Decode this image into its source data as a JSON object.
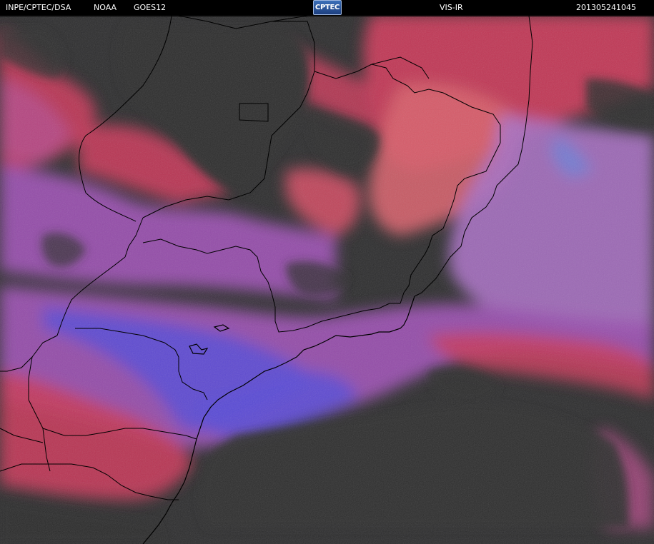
{
  "header": {
    "agency": "INPE/CPTEC/DSA",
    "source": "NOAA",
    "satellite": "GOES12",
    "logo_text": "CPTEC",
    "product": "VIS-IR",
    "timestamp": "201305241045"
  },
  "colors": {
    "background": "#000000",
    "ground": "#2e2e2f",
    "ir_cloud": "#c8385a",
    "warm_cloud": "#d8606b",
    "vis_cloud": "#9a4fb0",
    "deep_cloud": "#5a4bd6",
    "borders": "#000000",
    "text": "#ffffff"
  }
}
